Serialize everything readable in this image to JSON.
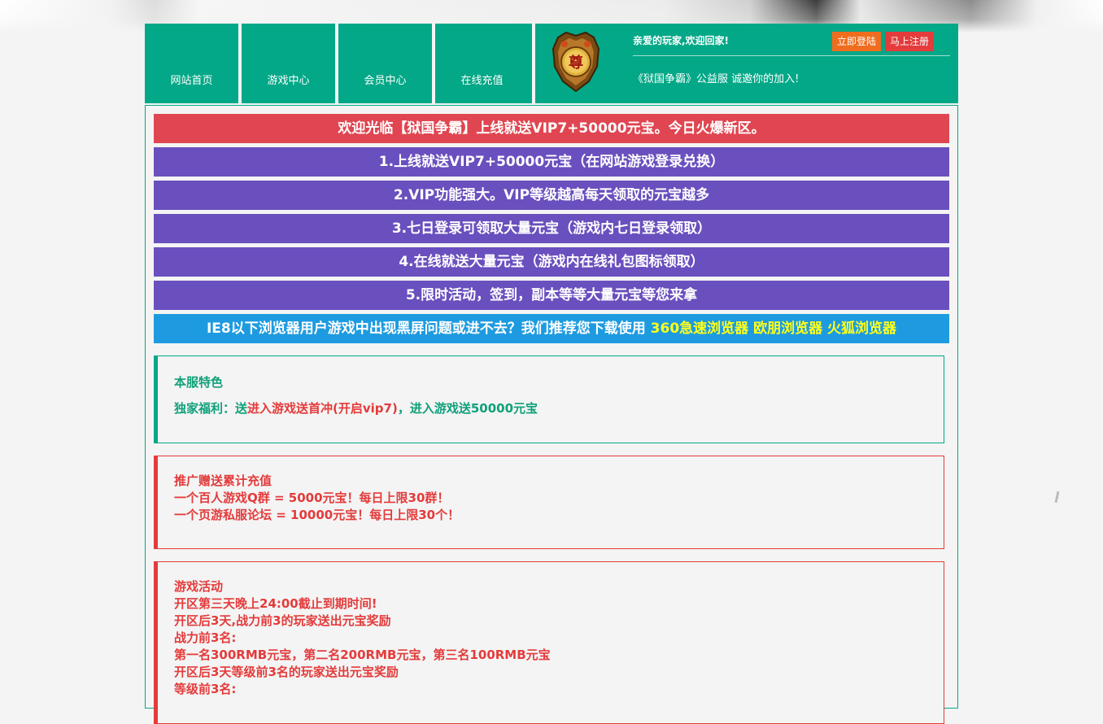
{
  "nav": {
    "home": "网站首页",
    "games": "游戏中心",
    "member": "会员中心",
    "recharge": "在线充值"
  },
  "emblem_char": "尊",
  "header": {
    "welcome": "亲爱的玩家,欢迎回家!",
    "login_label": "立即登陆",
    "register_label": "马上注册",
    "slogan": "《狱国争霸》公益服 诚邀你的加入!"
  },
  "banners": {
    "top": "欢迎光临【狱国争霸】上线就送VIP7+50000元宝。今日火爆新区。",
    "item1": "1.上线就送VIP7+50000元宝（在网站游戏登录兑换）",
    "item2": "2.VIP功能强大。VIP等级越高每天领取的元宝越多",
    "item3": "3.七日登录可领取大量元宝（游戏内七日登录领取）",
    "item4": "4.在线就送大量元宝（游戏内在线礼包图标领取）",
    "item5": "5.限时活动，签到，副本等等大量元宝等您来拿",
    "browser_text": "IE8以下浏览器用户游戏中出现黑屏问题或进不去？我们推荐您下载使用",
    "browser_links": "360急速浏览器 欧朋浏览器 火狐浏览器"
  },
  "features": {
    "title": "本服特色",
    "prefix": "独家福利：送",
    "highlight": "进入游戏送首冲(开启vip7)",
    "suffix": "，进入游戏送50000元宝"
  },
  "promo": {
    "title": "推广赠送累计充值",
    "line1": "一个百人游戏Q群 = 5000元宝！每日上限30群！",
    "line2": "一个页游私服论坛 = 10000元宝！每日上限30个！"
  },
  "activity": {
    "title": "游戏活动",
    "line1": "开区第三天晚上24:00截止到期时间!",
    "line2": "开区后3天,战力前3的玩家送出元宝奖励",
    "line3": "战力前3名:",
    "line4": "第一名300RMB元宝，第二名200RMB元宝，第三名100RMB元宝",
    "line5": "开区后3天等级前3名的玩家送出元宝奖励",
    "line6": "等级前3名:"
  },
  "colors": {
    "header_green": "#02a887",
    "banner_red": "#e04651",
    "banner_purple": "#6a4fbe",
    "banner_blue": "#1e9be0",
    "login_orange": "#ef6d1f",
    "register_red": "#e43b3b"
  }
}
